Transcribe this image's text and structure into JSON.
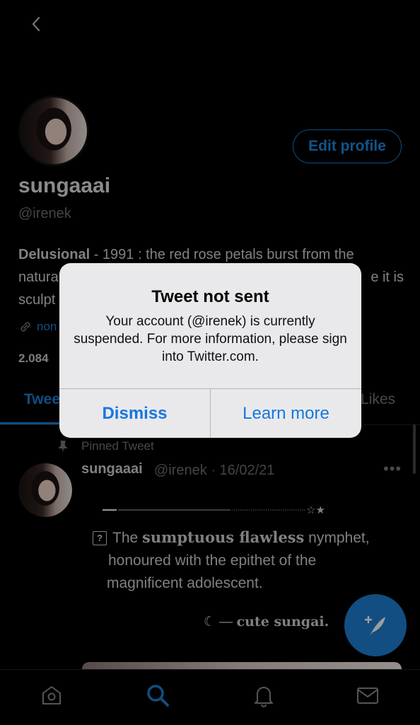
{
  "profile": {
    "display_name": "sungaaai",
    "handle": "@irenek",
    "edit_button": "Edit profile",
    "bio_bold": "Delusional",
    "bio_rest": " - 1991 : the red rose petals burst from the",
    "bio_line2_left": "natura",
    "bio_line2_right": "e it is",
    "bio_line3_left": "sculpt",
    "link_text": "non",
    "follow_count": "2.084"
  },
  "tabs": {
    "tweets_partial": "Twee",
    "likes_partial": "Likes"
  },
  "pinned_tweet": {
    "pinned_label": "Pinned Tweet",
    "author_name": "sungaaai",
    "meta": "@irenek · 16/02/21",
    "more": "•••",
    "stars": "☆★",
    "box_glyph": "?",
    "line1_pre": "The ",
    "line1_serif": "sumptuous flawless",
    "line1_post": " nymphet,",
    "line2": "honoured with the epithet of the",
    "line3": "magnificent adolescent.",
    "signoff_prefix": "☾ — ",
    "signoff": "cute sungai."
  },
  "alert": {
    "title": "Tweet not sent",
    "message": "Your account (@irenek) is currently suspended. For more information, please sign into Twitter.com.",
    "dismiss": "Dismiss",
    "learn_more": "Learn more"
  },
  "colors": {
    "accent": "#1d7fd1",
    "background": "#000000",
    "alert_bg": "#e9e9eb",
    "alert_button": "#1577e0"
  },
  "icons": {
    "back": "chevron-left-icon",
    "link": "link-icon",
    "pin": "pin-icon",
    "compose": "compose-tweet-icon",
    "nav": [
      "home-icon",
      "search-icon",
      "notifications-icon",
      "messages-icon"
    ]
  }
}
